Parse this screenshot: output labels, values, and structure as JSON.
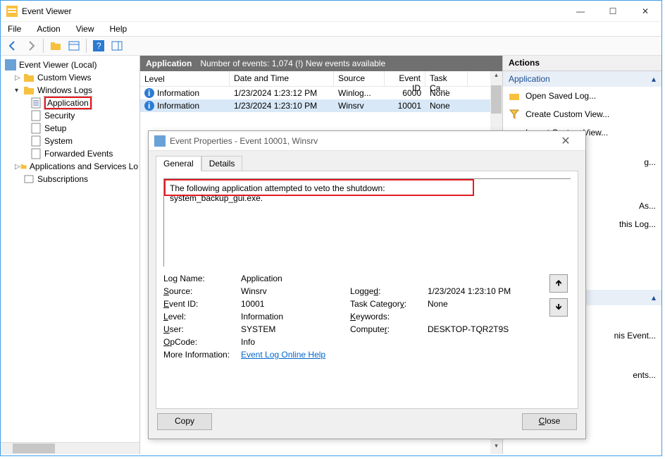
{
  "window": {
    "title": "Event Viewer"
  },
  "menu": {
    "file": "File",
    "action": "Action",
    "view": "View",
    "help": "Help"
  },
  "tree": {
    "root": "Event Viewer (Local)",
    "custom_views": "Custom Views",
    "windows_logs": "Windows Logs",
    "application": "Application",
    "security": "Security",
    "setup": "Setup",
    "system": "System",
    "forwarded": "Forwarded Events",
    "apps_services": "Applications and Services Lo",
    "subscriptions": "Subscriptions"
  },
  "mid": {
    "title": "Application",
    "count_text": "Number of events: 1,074 (!) New events available",
    "cols": {
      "level": "Level",
      "date": "Date and Time",
      "source": "Source",
      "eventid": "Event ID",
      "task": "Task Ca..."
    },
    "rows": [
      {
        "level": "Information",
        "date": "1/23/2024 1:23:12 PM",
        "source": "Winlog...",
        "eid": "6000",
        "task": "None"
      },
      {
        "level": "Information",
        "date": "1/23/2024 1:23:10 PM",
        "source": "Winsrv",
        "eid": "10001",
        "task": "None"
      }
    ]
  },
  "actions": {
    "title": "Actions",
    "section1": "Application",
    "items1": [
      "Open Saved Log...",
      "Create Custom View...",
      "Import Custom View..."
    ],
    "items1_clipped": [
      "g...",
      "As...",
      "this Log..."
    ],
    "section2_clipped": "",
    "items2_clipped": [
      "nis Event...",
      "ents..."
    ]
  },
  "dialog": {
    "title": "Event Properties - Event 10001, Winsrv",
    "tabs": {
      "general": "General",
      "details": "Details"
    },
    "message": "The following application attempted to veto the shutdown: system_backup_gui.exe.",
    "labels": {
      "log_name": "Log Name:",
      "source": "Source:",
      "event_id": "Event ID:",
      "level": "Level:",
      "user": "User:",
      "opcode": "OpCode:",
      "more_info": "More Information:",
      "logged": "Logged:",
      "task_cat": "Task Category:",
      "keywords": "Keywords:",
      "computer": "Computer:"
    },
    "values": {
      "log_name": "Application",
      "source": "Winsrv",
      "event_id": "10001",
      "level": "Information",
      "user": "SYSTEM",
      "opcode": "Info",
      "logged": "1/23/2024 1:23:10 PM",
      "task_cat": "None",
      "keywords": "",
      "computer": "DESKTOP-TQR2T9S",
      "more_link": "Event Log Online Help"
    },
    "buttons": {
      "copy": "Copy",
      "close": "Close"
    }
  }
}
